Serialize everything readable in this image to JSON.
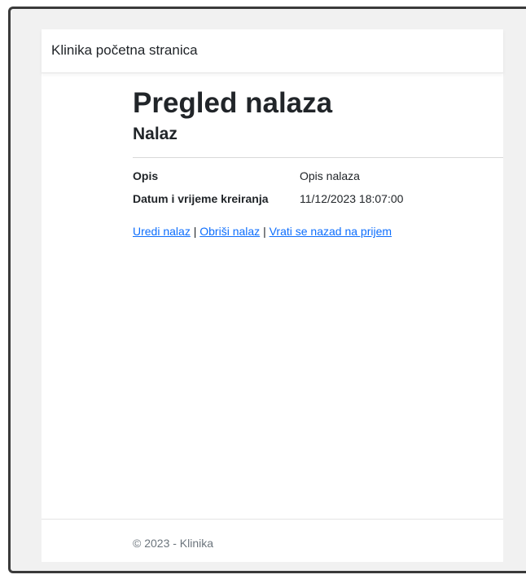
{
  "navbar": {
    "brand": "Klinika početna stranica"
  },
  "main": {
    "title": "Pregled nalaza",
    "subtitle": "Nalaz",
    "details": [
      {
        "label": "Opis",
        "value": "Opis nalaza"
      },
      {
        "label": "Datum i vrijeme kreiranja",
        "value": "11/12/2023 18:07:00"
      }
    ],
    "links": {
      "edit": "Uredi nalaz",
      "delete": "Obriši nalaz",
      "back": "Vrati se nazad na prijem",
      "separator": "|"
    }
  },
  "footer": {
    "text": "© 2023 - Klinika"
  },
  "colors": {
    "link": "#0d6efd",
    "text": "#212529",
    "muted": "#6c757d",
    "outer_background": "#f1f1f1",
    "frame_border": "#3a3a3a"
  }
}
